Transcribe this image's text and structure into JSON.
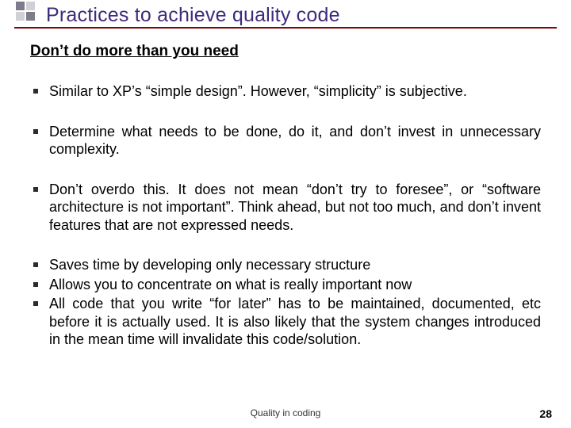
{
  "title": "Practices to achieve quality code",
  "subheading": "Don’t do more than you need",
  "bullets": [
    "Similar to XP’s “simple design”. However, “simplicity” is subjective.",
    "Determine what needs to be done, do it, and don’t invest in unnecessary complexity.",
    "Don’t overdo this. It does not mean “don’t try to foresee”, or “software architecture is not important”. Think ahead, but not too much, and don’t invent features that are not expressed needs.",
    "Saves time by developing only necessary structure",
    "Allows you to concentrate on what is really important now",
    "All code that you write “for later” has to be maintained, documented, etc before it is actually used. It is also likely that the system changes introduced in the mean time will invalidate this code/solution."
  ],
  "footer": {
    "caption": "Quality in coding",
    "page": "28"
  },
  "colors": {
    "title": "#3b2c7d",
    "underline": "#7d0a0a",
    "icon_dark": "#7c7c8a",
    "icon_light": "#d0d0d6"
  }
}
